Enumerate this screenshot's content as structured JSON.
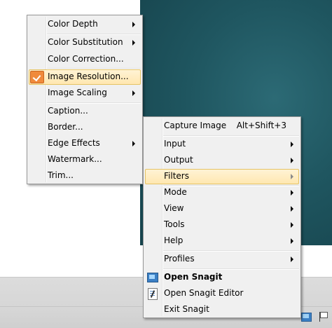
{
  "left_menu": {
    "items": [
      {
        "label": "Color Depth",
        "submenu": true
      },
      {
        "label": "Color Substitution",
        "submenu": true
      },
      {
        "label": "Color Correction...",
        "submenu": false
      },
      {
        "label": "Image Resolution...",
        "submenu": false,
        "checked": true,
        "highlighted": true
      },
      {
        "label": "Image Scaling",
        "submenu": true
      },
      {
        "label": "Caption...",
        "submenu": false
      },
      {
        "label": "Border...",
        "submenu": false
      },
      {
        "label": "Edge Effects",
        "submenu": true
      },
      {
        "label": "Watermark...",
        "submenu": false
      },
      {
        "label": "Trim...",
        "submenu": false
      }
    ]
  },
  "right_menu": {
    "items": [
      {
        "label": "Capture Image",
        "shortcut": "Alt+Shift+3"
      },
      {
        "label": "Input",
        "submenu": true
      },
      {
        "label": "Output",
        "submenu": true
      },
      {
        "label": "Filters",
        "submenu": true,
        "highlighted": true
      },
      {
        "label": "Mode",
        "submenu": true
      },
      {
        "label": "View",
        "submenu": true
      },
      {
        "label": "Tools",
        "submenu": true
      },
      {
        "label": "Help",
        "submenu": true
      },
      {
        "label": "Profiles",
        "submenu": true
      },
      {
        "label": "Open Snagit",
        "bold": true,
        "icon": "snagit-icon"
      },
      {
        "label": "Open Snagit Editor",
        "icon": "snagit-editor-icon"
      },
      {
        "label": "Exit Snagit"
      }
    ]
  },
  "colors": {
    "highlight": "#ffe7b0",
    "check_accent": "#f08a3c",
    "desktop": "#1f5660"
  }
}
